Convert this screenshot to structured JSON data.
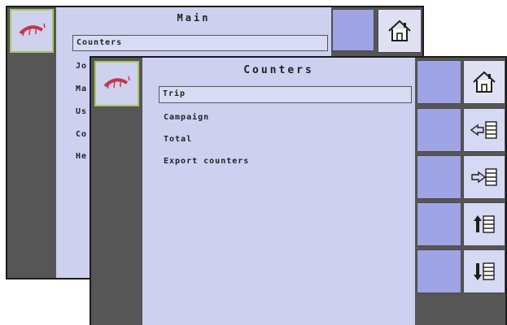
{
  "main_screen": {
    "title": "Main",
    "items": [
      "Counters",
      "Jo",
      "Ma",
      "Us",
      "Co",
      "He"
    ],
    "selected_index": 0,
    "icons": {
      "app": "sprayer-icon",
      "home": "home-icon"
    }
  },
  "counters_screen": {
    "title": "Counters",
    "items": [
      "Trip",
      "Campaign",
      "Total",
      "Export counters"
    ],
    "selected_index": 0,
    "side_buttons": [
      {
        "icon": "home-icon"
      },
      {
        "icon": "move-left-list-icon"
      },
      {
        "icon": "move-right-list-icon"
      },
      {
        "icon": "move-up-list-icon"
      },
      {
        "icon": "move-down-list-icon"
      }
    ]
  },
  "colors": {
    "content_bg": "#cdd0ef",
    "button_bg": "#9fa4e4",
    "frame": "#565656",
    "accent_border": "#a7c85a"
  }
}
